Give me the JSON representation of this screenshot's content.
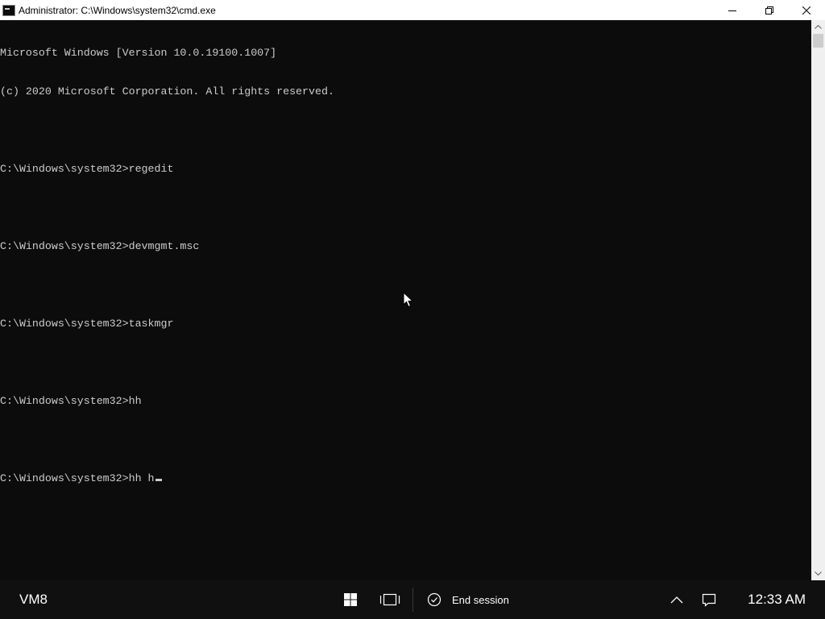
{
  "window": {
    "title": "Administrator: C:\\Windows\\system32\\cmd.exe",
    "icon": "cmd-icon",
    "controls": [
      "minimize-icon",
      "restore-icon",
      "close-icon"
    ]
  },
  "console": {
    "lines": [
      "Microsoft Windows [Version 10.0.19100.1007]",
      "(c) 2020 Microsoft Corporation. All rights reserved.",
      "",
      "C:\\Windows\\system32>regedit",
      "",
      "C:\\Windows\\system32>devmgmt.msc",
      "",
      "C:\\Windows\\system32>taskmgr",
      "",
      "C:\\Windows\\system32>hh",
      "",
      "C:\\Windows\\system32>hh h"
    ],
    "text_color": "#cccccc",
    "background": "#0c0c0c"
  },
  "taskbar": {
    "vm_label": "VM8",
    "icons": [
      "windows-start-icon",
      "task-view-icon",
      "check-circle-icon",
      "chevron-up-icon",
      "action-center-icon"
    ],
    "end_session_label": "End session",
    "clock": "12:33 AM",
    "background": "#101010"
  }
}
